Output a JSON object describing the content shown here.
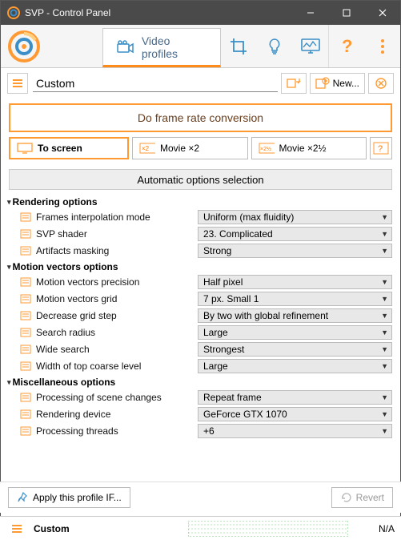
{
  "window": {
    "title": "SVP - Control Panel"
  },
  "header_tab": {
    "label": "Video profiles"
  },
  "profile": {
    "name": "Custom",
    "new_btn": "New..."
  },
  "main_action": {
    "label": "Do frame rate conversion"
  },
  "modes": {
    "m1": "To screen",
    "m2": "Movie ×2",
    "m3": "Movie ×2½"
  },
  "auto_header": "Automatic options selection",
  "groups": {
    "g1": "Rendering options",
    "g2": "Motion vectors options",
    "g3": "Miscellaneous options"
  },
  "opts": {
    "r1": {
      "label": "Frames interpolation mode",
      "value": "Uniform (max fluidity)"
    },
    "r2": {
      "label": "SVP shader",
      "value": "23. Complicated"
    },
    "r3": {
      "label": "Artifacts masking",
      "value": "Strong"
    },
    "m1": {
      "label": "Motion vectors precision",
      "value": "Half pixel"
    },
    "m2": {
      "label": "Motion vectors grid",
      "value": "7 px. Small 1"
    },
    "m3": {
      "label": "Decrease grid step",
      "value": "By two with global refinement"
    },
    "m4": {
      "label": "Search radius",
      "value": "Large"
    },
    "m5": {
      "label": "Wide search",
      "value": "Strongest"
    },
    "m6": {
      "label": "Width of top coarse level",
      "value": "Large"
    },
    "x1": {
      "label": "Processing of scene changes",
      "value": "Repeat frame"
    },
    "x2": {
      "label": "Rendering device",
      "value": "GeForce GTX 1070"
    },
    "x3": {
      "label": "Processing threads",
      "value": "+6"
    }
  },
  "bottom": {
    "apply": "Apply this profile IF...",
    "revert": "Revert"
  },
  "status": {
    "name": "Custom",
    "value": "N/A"
  },
  "colors": {
    "accent": "#ff8c1a",
    "toolbar_icon": "#3a8fc8"
  }
}
